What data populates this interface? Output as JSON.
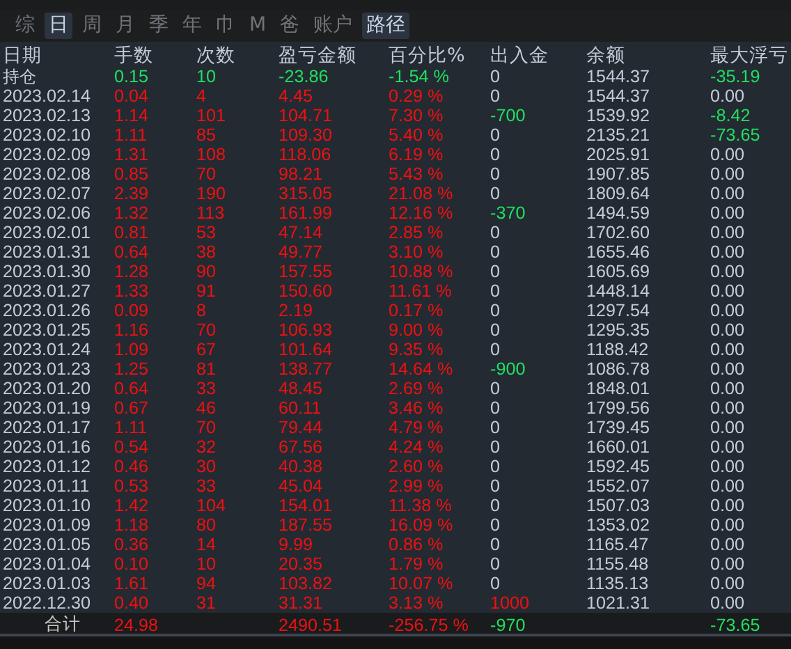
{
  "tabs": [
    {
      "label": "综",
      "selected": false
    },
    {
      "label": "日",
      "selected": true
    },
    {
      "label": "周",
      "selected": false
    },
    {
      "label": "月",
      "selected": false
    },
    {
      "label": "季",
      "selected": false
    },
    {
      "label": "年",
      "selected": false
    },
    {
      "label": "巾",
      "selected": false
    },
    {
      "label": "M",
      "selected": false
    },
    {
      "label": "爸",
      "selected": false
    },
    {
      "label": "账户",
      "selected": false
    },
    {
      "label": "路径",
      "selected": true
    }
  ],
  "columns": [
    "日期",
    "手数",
    "次数",
    "盈亏金额",
    "百分比%",
    "出入金",
    "余额",
    "最大浮亏"
  ],
  "rows": [
    {
      "date": "持仓",
      "lots": "0.15",
      "trades": "10",
      "pnl": "-23.86",
      "pct": "-1.54 %",
      "color": "#1fe060",
      "cash": {
        "text": "0",
        "color": "#c3ccd8"
      },
      "balance": "1544.37",
      "max_float": {
        "text": "-35.19",
        "color": "#1fe060"
      }
    },
    {
      "date": "2023.02.14",
      "lots": "0.04",
      "trades": "4",
      "pnl": "4.45",
      "pct": "0.29 %",
      "color": "#ee1111",
      "cash": {
        "text": "0",
        "color": "#c3ccd8"
      },
      "balance": "1544.37",
      "max_float": {
        "text": "0.00",
        "color": "#c3ccd8"
      }
    },
    {
      "date": "2023.02.13",
      "lots": "1.14",
      "trades": "101",
      "pnl": "104.71",
      "pct": "7.30 %",
      "color": "#ee1111",
      "cash": {
        "text": "-700",
        "color": "#1fe060"
      },
      "balance": "1539.92",
      "max_float": {
        "text": "-8.42",
        "color": "#1fe060"
      }
    },
    {
      "date": "2023.02.10",
      "lots": "1.11",
      "trades": "85",
      "pnl": "109.30",
      "pct": "5.40 %",
      "color": "#ee1111",
      "cash": {
        "text": "0",
        "color": "#c3ccd8"
      },
      "balance": "2135.21",
      "max_float": {
        "text": "-73.65",
        "color": "#1fe060"
      }
    },
    {
      "date": "2023.02.09",
      "lots": "1.31",
      "trades": "108",
      "pnl": "118.06",
      "pct": "6.19 %",
      "color": "#ee1111",
      "cash": {
        "text": "0",
        "color": "#c3ccd8"
      },
      "balance": "2025.91",
      "max_float": {
        "text": "0.00",
        "color": "#c3ccd8"
      }
    },
    {
      "date": "2023.02.08",
      "lots": "0.85",
      "trades": "70",
      "pnl": "98.21",
      "pct": "5.43 %",
      "color": "#ee1111",
      "cash": {
        "text": "0",
        "color": "#c3ccd8"
      },
      "balance": "1907.85",
      "max_float": {
        "text": "0.00",
        "color": "#c3ccd8"
      }
    },
    {
      "date": "2023.02.07",
      "lots": "2.39",
      "trades": "190",
      "pnl": "315.05",
      "pct": "21.08 %",
      "color": "#ee1111",
      "cash": {
        "text": "0",
        "color": "#c3ccd8"
      },
      "balance": "1809.64",
      "max_float": {
        "text": "0.00",
        "color": "#c3ccd8"
      }
    },
    {
      "date": "2023.02.06",
      "lots": "1.32",
      "trades": "113",
      "pnl": "161.99",
      "pct": "12.16 %",
      "color": "#ee1111",
      "cash": {
        "text": "-370",
        "color": "#1fe060"
      },
      "balance": "1494.59",
      "max_float": {
        "text": "0.00",
        "color": "#c3ccd8"
      }
    },
    {
      "date": "2023.02.01",
      "lots": "0.81",
      "trades": "53",
      "pnl": "47.14",
      "pct": "2.85 %",
      "color": "#ee1111",
      "cash": {
        "text": "0",
        "color": "#c3ccd8"
      },
      "balance": "1702.60",
      "max_float": {
        "text": "0.00",
        "color": "#c3ccd8"
      }
    },
    {
      "date": "2023.01.31",
      "lots": "0.64",
      "trades": "38",
      "pnl": "49.77",
      "pct": "3.10 %",
      "color": "#ee1111",
      "cash": {
        "text": "0",
        "color": "#c3ccd8"
      },
      "balance": "1655.46",
      "max_float": {
        "text": "0.00",
        "color": "#c3ccd8"
      }
    },
    {
      "date": "2023.01.30",
      "lots": "1.28",
      "trades": "90",
      "pnl": "157.55",
      "pct": "10.88 %",
      "color": "#ee1111",
      "cash": {
        "text": "0",
        "color": "#c3ccd8"
      },
      "balance": "1605.69",
      "max_float": {
        "text": "0.00",
        "color": "#c3ccd8"
      }
    },
    {
      "date": "2023.01.27",
      "lots": "1.33",
      "trades": "91",
      "pnl": "150.60",
      "pct": "11.61 %",
      "color": "#ee1111",
      "cash": {
        "text": "0",
        "color": "#c3ccd8"
      },
      "balance": "1448.14",
      "max_float": {
        "text": "0.00",
        "color": "#c3ccd8"
      }
    },
    {
      "date": "2023.01.26",
      "lots": "0.09",
      "trades": "8",
      "pnl": "2.19",
      "pct": "0.17 %",
      "color": "#ee1111",
      "cash": {
        "text": "0",
        "color": "#c3ccd8"
      },
      "balance": "1297.54",
      "max_float": {
        "text": "0.00",
        "color": "#c3ccd8"
      }
    },
    {
      "date": "2023.01.25",
      "lots": "1.16",
      "trades": "70",
      "pnl": "106.93",
      "pct": "9.00 %",
      "color": "#ee1111",
      "cash": {
        "text": "0",
        "color": "#c3ccd8"
      },
      "balance": "1295.35",
      "max_float": {
        "text": "0.00",
        "color": "#c3ccd8"
      }
    },
    {
      "date": "2023.01.24",
      "lots": "1.09",
      "trades": "67",
      "pnl": "101.64",
      "pct": "9.35 %",
      "color": "#ee1111",
      "cash": {
        "text": "0",
        "color": "#c3ccd8"
      },
      "balance": "1188.42",
      "max_float": {
        "text": "0.00",
        "color": "#c3ccd8"
      }
    },
    {
      "date": "2023.01.23",
      "lots": "1.25",
      "trades": "81",
      "pnl": "138.77",
      "pct": "14.64 %",
      "color": "#ee1111",
      "cash": {
        "text": "-900",
        "color": "#1fe060"
      },
      "balance": "1086.78",
      "max_float": {
        "text": "0.00",
        "color": "#c3ccd8"
      }
    },
    {
      "date": "2023.01.20",
      "lots": "0.64",
      "trades": "33",
      "pnl": "48.45",
      "pct": "2.69 %",
      "color": "#ee1111",
      "cash": {
        "text": "0",
        "color": "#c3ccd8"
      },
      "balance": "1848.01",
      "max_float": {
        "text": "0.00",
        "color": "#c3ccd8"
      }
    },
    {
      "date": "2023.01.19",
      "lots": "0.67",
      "trades": "46",
      "pnl": "60.11",
      "pct": "3.46 %",
      "color": "#ee1111",
      "cash": {
        "text": "0",
        "color": "#c3ccd8"
      },
      "balance": "1799.56",
      "max_float": {
        "text": "0.00",
        "color": "#c3ccd8"
      }
    },
    {
      "date": "2023.01.17",
      "lots": "1.11",
      "trades": "70",
      "pnl": "79.44",
      "pct": "4.79 %",
      "color": "#ee1111",
      "cash": {
        "text": "0",
        "color": "#c3ccd8"
      },
      "balance": "1739.45",
      "max_float": {
        "text": "0.00",
        "color": "#c3ccd8"
      }
    },
    {
      "date": "2023.01.16",
      "lots": "0.54",
      "trades": "32",
      "pnl": "67.56",
      "pct": "4.24 %",
      "color": "#ee1111",
      "cash": {
        "text": "0",
        "color": "#c3ccd8"
      },
      "balance": "1660.01",
      "max_float": {
        "text": "0.00",
        "color": "#c3ccd8"
      }
    },
    {
      "date": "2023.01.12",
      "lots": "0.46",
      "trades": "30",
      "pnl": "40.38",
      "pct": "2.60 %",
      "color": "#ee1111",
      "cash": {
        "text": "0",
        "color": "#c3ccd8"
      },
      "balance": "1592.45",
      "max_float": {
        "text": "0.00",
        "color": "#c3ccd8"
      }
    },
    {
      "date": "2023.01.11",
      "lots": "0.53",
      "trades": "33",
      "pnl": "45.04",
      "pct": "2.99 %",
      "color": "#ee1111",
      "cash": {
        "text": "0",
        "color": "#c3ccd8"
      },
      "balance": "1552.07",
      "max_float": {
        "text": "0.00",
        "color": "#c3ccd8"
      }
    },
    {
      "date": "2023.01.10",
      "lots": "1.42",
      "trades": "104",
      "pnl": "154.01",
      "pct": "11.38 %",
      "color": "#ee1111",
      "cash": {
        "text": "0",
        "color": "#c3ccd8"
      },
      "balance": "1507.03",
      "max_float": {
        "text": "0.00",
        "color": "#c3ccd8"
      }
    },
    {
      "date": "2023.01.09",
      "lots": "1.18",
      "trades": "80",
      "pnl": "187.55",
      "pct": "16.09 %",
      "color": "#ee1111",
      "cash": {
        "text": "0",
        "color": "#c3ccd8"
      },
      "balance": "1353.02",
      "max_float": {
        "text": "0.00",
        "color": "#c3ccd8"
      }
    },
    {
      "date": "2023.01.05",
      "lots": "0.36",
      "trades": "14",
      "pnl": "9.99",
      "pct": "0.86 %",
      "color": "#ee1111",
      "cash": {
        "text": "0",
        "color": "#c3ccd8"
      },
      "balance": "1165.47",
      "max_float": {
        "text": "0.00",
        "color": "#c3ccd8"
      }
    },
    {
      "date": "2023.01.04",
      "lots": "0.10",
      "trades": "10",
      "pnl": "20.35",
      "pct": "1.79 %",
      "color": "#ee1111",
      "cash": {
        "text": "0",
        "color": "#c3ccd8"
      },
      "balance": "1155.48",
      "max_float": {
        "text": "0.00",
        "color": "#c3ccd8"
      }
    },
    {
      "date": "2023.01.03",
      "lots": "1.61",
      "trades": "94",
      "pnl": "103.82",
      "pct": "10.07 %",
      "color": "#ee1111",
      "cash": {
        "text": "0",
        "color": "#c3ccd8"
      },
      "balance": "1135.13",
      "max_float": {
        "text": "0.00",
        "color": "#c3ccd8"
      }
    },
    {
      "date": "2022.12.30",
      "lots": "0.40",
      "trades": "31",
      "pnl": "31.31",
      "pct": "3.13 %",
      "color": "#ee1111",
      "cash": {
        "text": "1000",
        "color": "#ee1111"
      },
      "balance": "1021.31",
      "max_float": {
        "text": "0.00",
        "color": "#c3ccd8"
      }
    }
  ],
  "total": {
    "label": "合计",
    "lots": "24.98",
    "pnl": "2490.51",
    "pct": "-256.75 %",
    "cash": "-970",
    "max_float": "-73.65"
  }
}
